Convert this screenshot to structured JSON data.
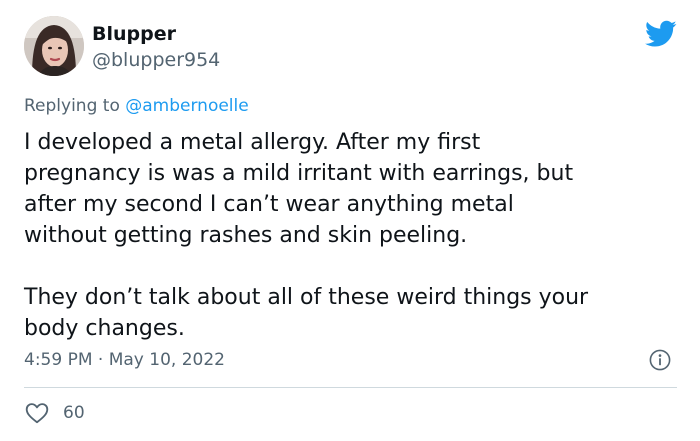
{
  "author": {
    "display_name": "Blupper",
    "handle": "@blupper954",
    "avatar_icon": "user-avatar-photo"
  },
  "reply": {
    "prefix": "Replying to",
    "mention": "@ambernoelle"
  },
  "tweet": {
    "lines_paragraph_1": [
      "I developed a metal allergy. After my first",
      "pregnancy is was a mild irritant with earrings, but",
      "after my second I can’t wear anything metal",
      "without getting rashes and skin peeling."
    ],
    "lines_paragraph_2": [
      "They don’t talk about all of these weird things your",
      "body changes."
    ]
  },
  "meta": {
    "timestamp": "4:59 PM · May 10, 2022"
  },
  "engagement": {
    "likes": "60"
  },
  "icons": {
    "brand": "twitter-bird-icon",
    "info": "info-icon",
    "like": "heart-icon"
  },
  "colors": {
    "brand_blue": "#1d9bf0",
    "text_primary": "#0f1419",
    "text_secondary": "#536471",
    "divider": "#cfd9de"
  }
}
